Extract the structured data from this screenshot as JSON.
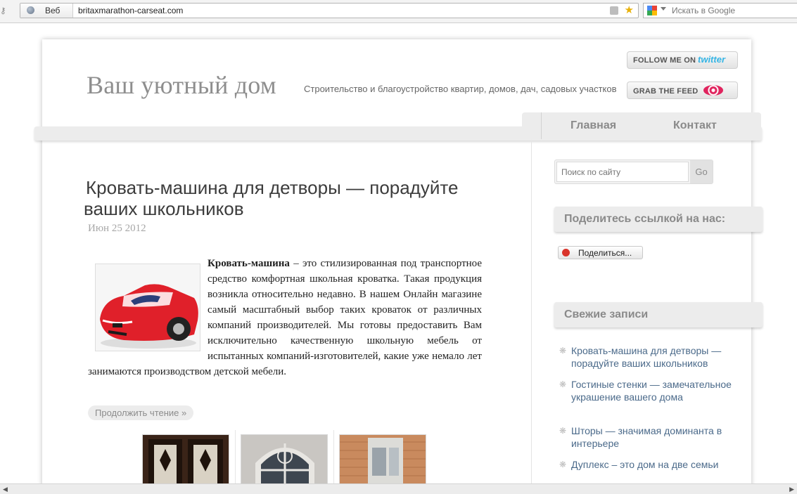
{
  "browser": {
    "web_chip_label": "Веб",
    "url": "britaxmarathon-carseat.com",
    "search_placeholder": "Искать в Google"
  },
  "header": {
    "site_title": "Ваш уютный дом",
    "site_description": "Строительство и благоустройство квартир, домов, дач, садовых участков",
    "follow_label": "FOLLOW ME ON",
    "follow_brand": "twitter",
    "feed_label": "GRAB THE FEED"
  },
  "nav": {
    "items": [
      {
        "label": "Главная"
      },
      {
        "label": "Контакт"
      }
    ]
  },
  "post": {
    "title_line1": "Кровать-машина для детворы — порадуйте",
    "title_line2": "ваших школьников",
    "date": "Июн 25 2012",
    "lead_bold": "Кровать-машина",
    "body": " – это стилизированная под транспортное средство комфортная школьная кроватка. Такая продукция возникла относительно недавно. В нашем Онлайн магазине самый масштабный выбор таких кроваток от различных компаний производителей. Мы готовы предоставить Вам исключительно качественную школьную мебель от испытанных компаний-изготовителей, какие уже немало лет занимаются производством детской мебели.",
    "read_more": "Продолжить чтение »"
  },
  "sidebar": {
    "search_placeholder": "Поиск по сайту",
    "search_button": "Go",
    "share_heading": "Поделитесь ссылкой на нас:",
    "share_button": "Поделиться...",
    "recent_heading": "Свежие записи",
    "recent": [
      {
        "title": "Кровать-машина для детворы — порадуйте ваших школьников"
      },
      {
        "title": "Гостиные стенки — замечательное украшение вашего дома"
      },
      {
        "title": "Шторы — значимая доминанта в интерьере"
      },
      {
        "title": "Дуплекс – это дом на две семьи"
      }
    ]
  },
  "colors": {
    "accent_link": "#4b6a8a",
    "twitter_blue": "#35b5e5",
    "feed_red": "#e0245e",
    "car_red": "#e0202a"
  }
}
